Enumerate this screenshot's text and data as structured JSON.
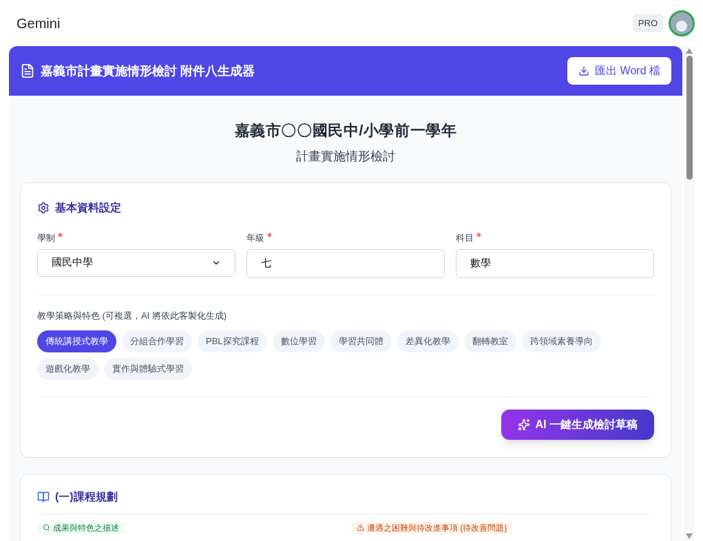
{
  "app_bar": {
    "title": "Gemini",
    "badge": "PRO"
  },
  "header": {
    "title": "嘉義市計畫實施情形檢討 附件八生成器",
    "export_button": "匯出 Word 檔"
  },
  "page_title": {
    "line1": "嘉義市〇〇國民中/小學前一學年",
    "line2": "計畫實施情形檢討"
  },
  "basic_settings": {
    "title": "基本資料設定",
    "fields": [
      {
        "kind": "select",
        "label": "學制",
        "required": true,
        "value": "國民中學"
      },
      {
        "kind": "text",
        "label": "年級",
        "required": true,
        "value": "七"
      },
      {
        "kind": "text",
        "label": "科目",
        "required": true,
        "value": "數學"
      }
    ],
    "strategies_label": "教學策略與特色 (可複選，AI 將依此客製化生成)",
    "strategies": [
      {
        "label": "傳統講授式教學",
        "selected": true
      },
      {
        "label": "分組合作學習",
        "selected": false
      },
      {
        "label": "PBL探究課程",
        "selected": false
      },
      {
        "label": "數位學習",
        "selected": false
      },
      {
        "label": "學習共同體",
        "selected": false
      },
      {
        "label": "差異化教學",
        "selected": false
      },
      {
        "label": "翻轉教室",
        "selected": false
      },
      {
        "label": "跨領域素養導向",
        "selected": false
      },
      {
        "label": "遊戲化教學",
        "selected": false
      },
      {
        "label": "實作與體驗式學習",
        "selected": false
      }
    ],
    "generate_button": "AI 一鍵生成檢討草稿"
  },
  "curriculum": {
    "title": "(一)課程規劃",
    "tags": [
      {
        "kind": "success",
        "label": "成果與特色之描述"
      },
      {
        "kind": "warning",
        "label": "遭遇之困難與待改進事項 (待改善問題)"
      }
    ]
  }
}
